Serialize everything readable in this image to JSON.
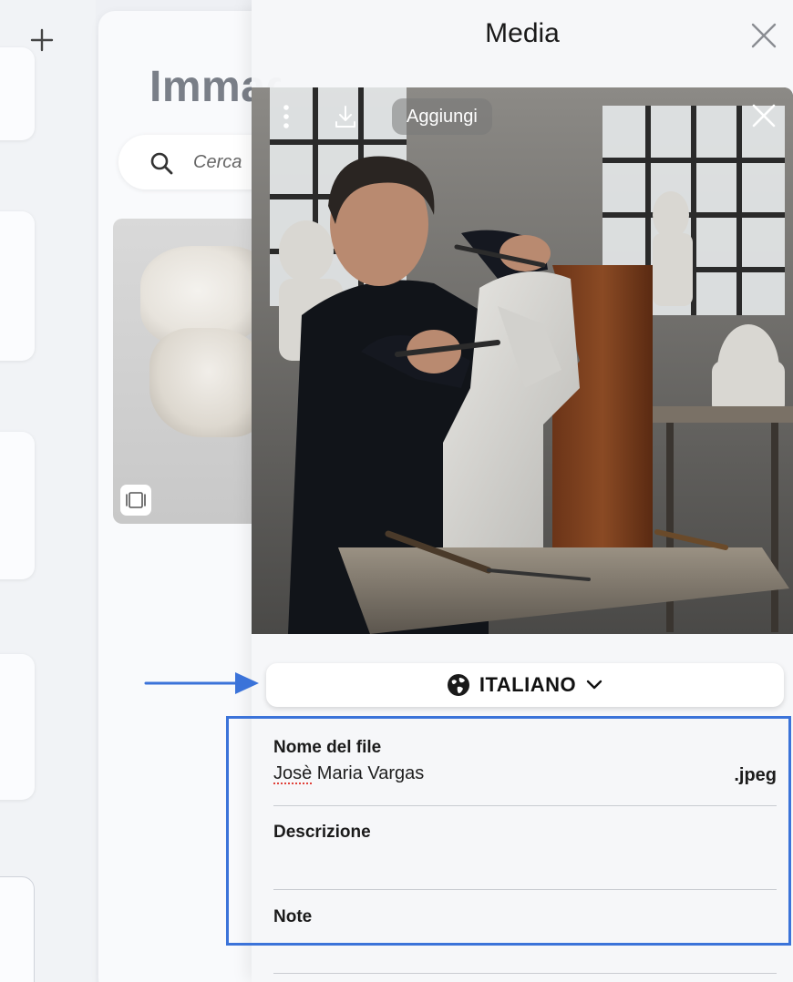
{
  "background": {
    "add_icon": "plus-icon",
    "page_title": "Immagini e video",
    "search": {
      "placeholder": "Cerca",
      "icon": "search-icon"
    },
    "thumbnail_badge_icon": "carousel-icon"
  },
  "media_panel": {
    "title": "Media",
    "close_icon": "close-icon",
    "image_toolbar": {
      "more_icon": "more-vertical-icon",
      "download_icon": "download-icon",
      "add_label": "Aggiungi",
      "close_icon": "close-icon"
    },
    "language": {
      "icon": "globe-icon",
      "label": "ITALIANO",
      "dropdown_icon": "chevron-down-icon"
    },
    "fields": {
      "file_name_label": "Nome del file",
      "file_name_value_first": "Josè",
      "file_name_value_rest": " Maria Vargas",
      "file_extension": ".jpeg",
      "description_label": "Descrizione",
      "description_value": "",
      "notes_label": "Note"
    }
  },
  "colors": {
    "annotation_blue": "#3b73d9",
    "panel_bg": "#f6f7f9",
    "text_primary": "#111111"
  }
}
